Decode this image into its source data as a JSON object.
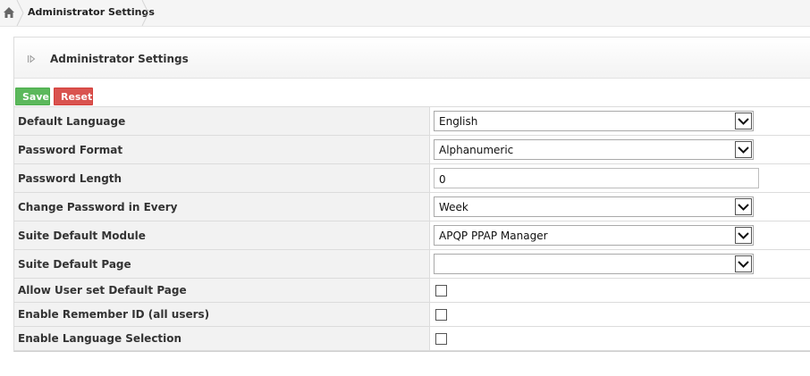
{
  "breadcrumb": {
    "home_icon": "home-icon",
    "current": "Administrator Settings"
  },
  "panel": {
    "toggle_icon": "collapse-arrow-icon",
    "title": "Administrator Settings"
  },
  "toolbar": {
    "save_label": "Save",
    "reset_label": "Reset",
    "save_color": "#5cb85c",
    "reset_color": "#d9534f"
  },
  "settings": [
    {
      "label": "Default Language",
      "type": "select",
      "value": "English"
    },
    {
      "label": "Password Format",
      "type": "select",
      "value": "Alphanumeric"
    },
    {
      "label": "Password Length",
      "type": "text",
      "value": "0"
    },
    {
      "label": "Change Password in Every",
      "type": "select",
      "value": "Week"
    },
    {
      "label": "Suite Default Module",
      "type": "select",
      "value": "APQP PPAP Manager"
    },
    {
      "label": "Suite Default Page",
      "type": "select",
      "value": ""
    },
    {
      "label": "Allow User set Default Page",
      "type": "checkbox",
      "checked": false
    },
    {
      "label": "Enable Remember ID (all users)",
      "type": "checkbox",
      "checked": false
    },
    {
      "label": "Enable Language Selection",
      "type": "checkbox",
      "checked": false
    }
  ]
}
